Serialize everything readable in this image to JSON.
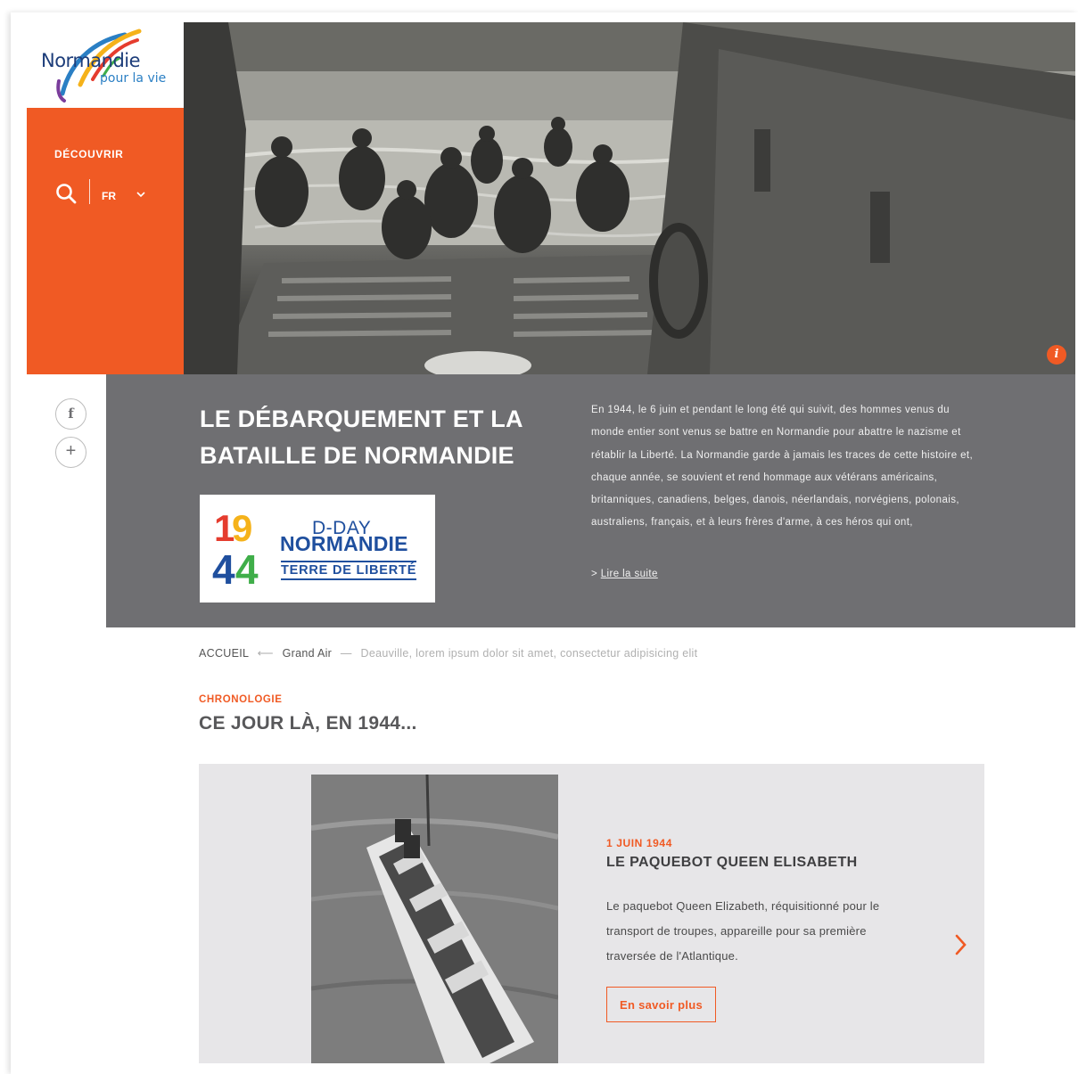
{
  "logo": {
    "name": "Normandie",
    "tagline": "pour la vie"
  },
  "menu": {
    "discover_label": "DÉCOUVRIR",
    "language": "FR"
  },
  "hero": {
    "info_label": "i"
  },
  "intro": {
    "title": "LE DÉBARQUEMENT ET LA BATAILLE DE NORMANDIE",
    "text": "En 1944, le 6 juin et pendant le long été qui suivit, des hommes venus du monde entier sont venus se battre en Normandie pour abattre le nazisme et rétablir la Liberté. La Normandie garde à jamais les traces de cette histoire et, chaque année, se souvient et rend hommage aux vétérans américains, britanniques, canadiens, belges, danois, néerlandais, norvégiens, polonais, australiens, français, et à leurs frères d'arme, à ces héros qui ont,",
    "read_more_prefix": ">",
    "read_more_label": "Lire la suite",
    "badge": {
      "digits": "1944",
      "line1": "D-DAY",
      "line2": "NORMANDIE",
      "line3": "TERRE DE LIBERTÉ"
    }
  },
  "social": {
    "facebook_label": "f",
    "more_label": "+"
  },
  "breadcrumb": {
    "items": [
      "ACCUEIL",
      "Grand Air",
      "Deauville, lorem ipsum dolor sit amet, consectetur adipisicing elit"
    ],
    "separators": [
      "⟵",
      "—"
    ]
  },
  "section": {
    "kicker": "CHRONOLOGIE",
    "title": "CE JOUR LÀ, EN 1944..."
  },
  "card": {
    "date": "1 JUIN 1944",
    "title": "LE PAQUEBOT QUEEN ELISABETH",
    "text": "Le paquebot Queen Elizabeth, réquisitionné pour le transport de troupes, appareille pour sa première traversée de l'Atlantique.",
    "button_label": "En savoir plus"
  },
  "colors": {
    "accent": "#f05a24",
    "band": "#6f6f72",
    "card_bg": "#e7e6e8"
  },
  "icons": [
    "search-icon",
    "chevron-down-icon",
    "info-icon",
    "facebook-icon",
    "plus-icon",
    "chevron-right-icon"
  ]
}
